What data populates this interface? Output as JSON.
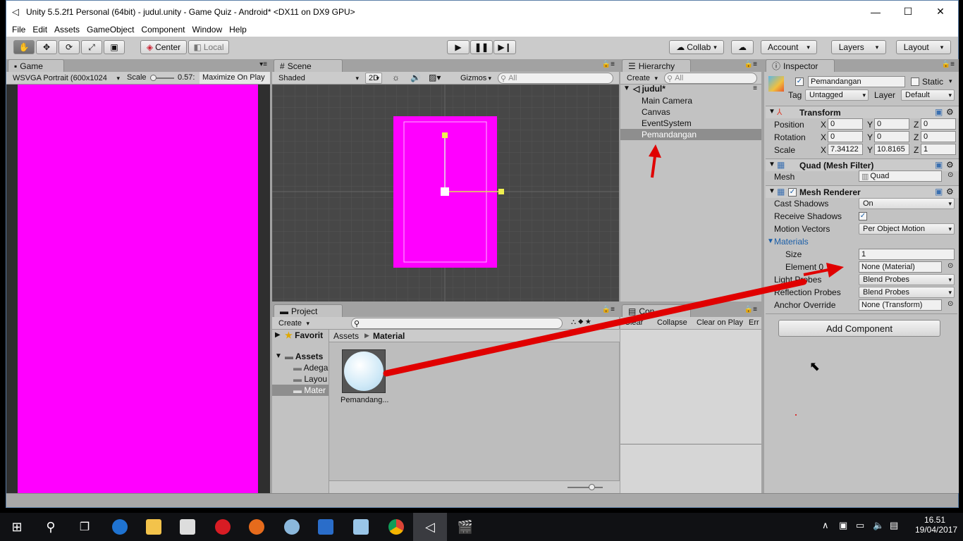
{
  "window": {
    "title": "Unity 5.5.2f1 Personal (64bit) - judul.unity - Game Quiz - Android* <DX11 on DX9 GPU>",
    "minimize_icon": "minimize-icon",
    "maximize_icon": "maximize-icon",
    "close_icon": "close-icon"
  },
  "menu": [
    "File",
    "Edit",
    "Assets",
    "GameObject",
    "Component",
    "Window",
    "Help"
  ],
  "toolbar": {
    "pivot": "Center",
    "space": "Local",
    "collab": "Collab",
    "account": "Account",
    "layers": "Layers",
    "layout": "Layout"
  },
  "game": {
    "tab": "Game",
    "resolution": "WSVGA Portrait (600x1024",
    "scale_label": "Scale",
    "scale_value": "0.57:",
    "maximize": "Maximize On Play",
    "fill_color": "#ff00ff"
  },
  "scene": {
    "tab": "Scene",
    "shading": "Shaded",
    "mode2d": "2D",
    "gizmos": "Gizmos",
    "search_placeholder": "All"
  },
  "hierarchy": {
    "tab": "Hierarchy",
    "create": "Create",
    "search_placeholder": "All",
    "scene_name": "judul*",
    "items": [
      "Main Camera",
      "Canvas",
      "EventSystem",
      "Pemandangan"
    ],
    "selected_index": 3
  },
  "project": {
    "tab": "Project",
    "create": "Create",
    "favorites": "Favorit",
    "assets": "Assets",
    "folders": [
      "Adega",
      "Layou",
      "Mater"
    ],
    "breadcrumb_root": "Assets",
    "breadcrumb_child": "Material",
    "asset_name": "Pemandang..."
  },
  "console": {
    "tab": "Con",
    "buttons": [
      "Clear",
      "Collapse",
      "Clear on Play",
      "Err"
    ]
  },
  "inspector": {
    "tab": "Inspector",
    "object_name": "Pemandangan",
    "static_label": "Static",
    "tag_label": "Tag",
    "tag_value": "Untagged",
    "layer_label": "Layer",
    "layer_value": "Default",
    "transform": {
      "title": "Transform",
      "position_label": "Position",
      "rotation_label": "Rotation",
      "scale_label": "Scale",
      "position": {
        "x": "0",
        "y": "0",
        "z": "0"
      },
      "rotation": {
        "x": "0",
        "y": "0",
        "z": "0"
      },
      "scale": {
        "x": "7.34122",
        "y": "10.8165",
        "z": "1"
      }
    },
    "mesh_filter": {
      "title": "Quad (Mesh Filter)",
      "mesh_label": "Mesh",
      "mesh_value": "Quad"
    },
    "mesh_renderer": {
      "title": "Mesh Renderer",
      "cast_shadows_label": "Cast Shadows",
      "cast_shadows_value": "On",
      "receive_shadows_label": "Receive Shadows",
      "motion_vectors_label": "Motion Vectors",
      "motion_vectors_value": "Per Object Motion",
      "materials_label": "Materials",
      "size_label": "Size",
      "size_value": "1",
      "element_label": "Element 0",
      "element_value": "None (Material)",
      "light_probes_label": "Light Probes",
      "light_probes_value": "Blend Probes",
      "reflection_probes_label": "Reflection Probes",
      "reflection_probes_value": "Blend Probes",
      "anchor_override_label": "Anchor Override",
      "anchor_override_value": "None (Transform)"
    },
    "add_component": "Add Component"
  },
  "taskbar": {
    "time": "16.51",
    "date": "19/04/2017"
  },
  "annotation_color": "#e00000"
}
